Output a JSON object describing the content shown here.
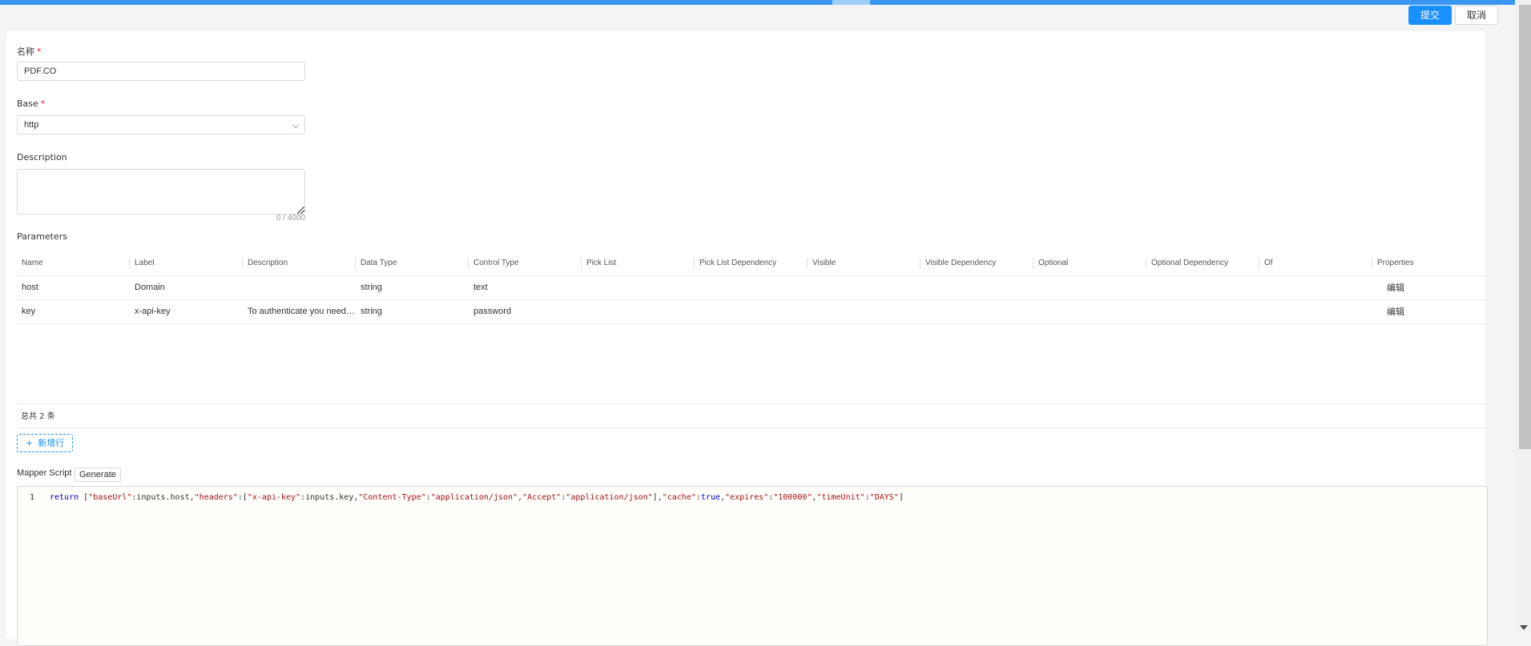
{
  "header": {
    "submit_label": "提交",
    "cancel_label": "取消"
  },
  "form": {
    "name": {
      "label": "名称",
      "required": "*",
      "value": "PDF.CO"
    },
    "base": {
      "label": "Base",
      "required": "*",
      "value": "http"
    },
    "description": {
      "label": "Description",
      "value": "",
      "counter": "0 / 4000"
    }
  },
  "parameters": {
    "title": "Parameters",
    "columns": [
      "Name",
      "Label",
      "Description",
      "Data Type",
      "Control Type",
      "Pick List",
      "Pick List Dependency",
      "Visible",
      "Visible Dependency",
      "Optional",
      "Optional Dependency",
      "Of",
      "Properties"
    ],
    "rows": [
      [
        "host",
        "Domain",
        "",
        "string",
        "text",
        "",
        "",
        "",
        "",
        "",
        "",
        "",
        "编辑"
      ],
      [
        "key",
        "x-api-key",
        "To authenticate you need ...",
        "string",
        "password",
        "",
        "",
        "",
        "",
        "",
        "",
        "",
        "编辑"
      ]
    ],
    "total": "总共 2 条",
    "add_row": "新增行"
  },
  "mapper": {
    "label": "Mapper Script",
    "generate": "Generate",
    "line_number": "1",
    "tokens": [
      {
        "t": "kw",
        "v": "return"
      },
      {
        "t": "pl",
        "v": " ["
      },
      {
        "t": "str",
        "v": "\"baseUrl\""
      },
      {
        "t": "pl",
        "v": ":inputs.host,"
      },
      {
        "t": "str",
        "v": "\"headers\""
      },
      {
        "t": "pl",
        "v": ":["
      },
      {
        "t": "str",
        "v": "\"x-api-key\""
      },
      {
        "t": "pl",
        "v": ":inputs.key,"
      },
      {
        "t": "str",
        "v": "\"Content-Type\""
      },
      {
        "t": "pl",
        "v": ":"
      },
      {
        "t": "str",
        "v": "\"application/json\""
      },
      {
        "t": "pl",
        "v": ","
      },
      {
        "t": "str",
        "v": "\"Accept\""
      },
      {
        "t": "pl",
        "v": ":"
      },
      {
        "t": "str",
        "v": "\"application/json\""
      },
      {
        "t": "pl",
        "v": "],"
      },
      {
        "t": "str",
        "v": "\"cache\""
      },
      {
        "t": "pl",
        "v": ":"
      },
      {
        "t": "kw",
        "v": "true"
      },
      {
        "t": "pl",
        "v": ","
      },
      {
        "t": "str",
        "v": "\"expires\""
      },
      {
        "t": "pl",
        "v": ":"
      },
      {
        "t": "str",
        "v": "\"100000\""
      },
      {
        "t": "pl",
        "v": ","
      },
      {
        "t": "str",
        "v": "\"timeUnit\""
      },
      {
        "t": "pl",
        "v": ":"
      },
      {
        "t": "str",
        "v": "\"DAYS\""
      },
      {
        "t": "pl",
        "v": "]"
      }
    ]
  },
  "colors": {
    "primary": "#1890ff",
    "required": "#f5222d",
    "top_bar": "#3a96f0"
  }
}
